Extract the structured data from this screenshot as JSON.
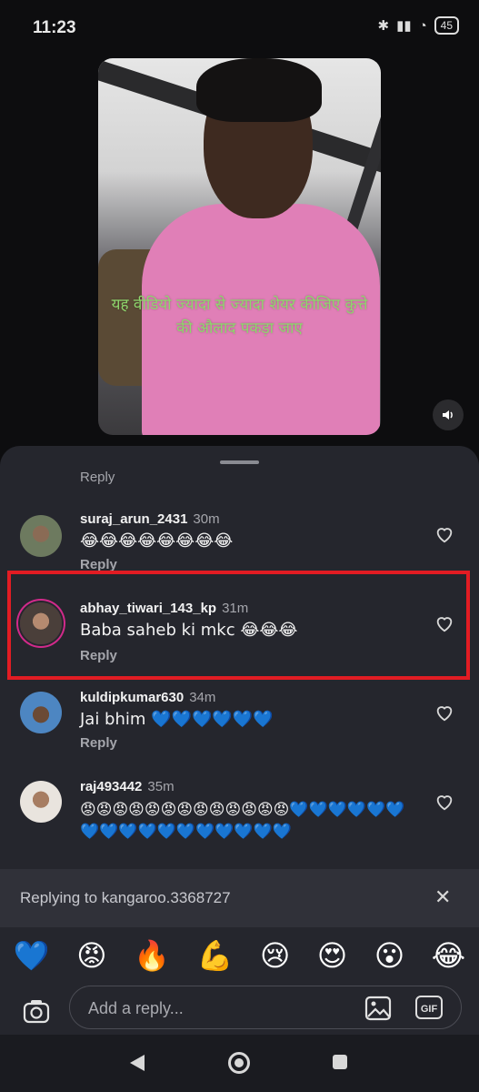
{
  "status_bar": {
    "time": "11:23",
    "battery": "45"
  },
  "video": {
    "caption": "यह वीडियो ज्यादा से ज्यादा शेयर कीजिए कुत्ते की औलाद पकड़ा जाए",
    "mute_icon": "speaker-icon"
  },
  "comments": {
    "partial_reply_label": "Reply",
    "items": [
      {
        "username": "suraj_arun_2431",
        "time": "30m",
        "text": "😂😂😂😂😂😂😂😂",
        "reply_label": "Reply"
      },
      {
        "username": "abhay_tiwari_143_kp",
        "time": "31m",
        "text": "Baba saheb ki mkc 😂😂😂",
        "reply_label": "Reply"
      },
      {
        "username": "kuldipkumar630",
        "time": "34m",
        "text": "Jai bhim 💙💙💙💙💙💙",
        "reply_label": "Reply"
      },
      {
        "username": "raj493442",
        "time": "35m",
        "text": "😡😡😡😡😡😡😡😡😡😡😡😡😡💙💙💙💙💙💙💙💙💙💙💙💙💙💙💙💙💙",
        "reply_label": "Reply"
      }
    ]
  },
  "replying_bar": {
    "text": "Replying to kangaroo.3368727",
    "close": "✕"
  },
  "emoji_bar": [
    "💙",
    "😡",
    "🔥",
    "💪",
    "😢",
    "😍",
    "😮",
    "😂"
  ],
  "composer": {
    "placeholder": "Add a reply...",
    "gif_label": "GIF"
  },
  "colors": {
    "highlight": "#e21c23",
    "sheet_bg": "#25262d",
    "caption": "#8fd66d"
  }
}
